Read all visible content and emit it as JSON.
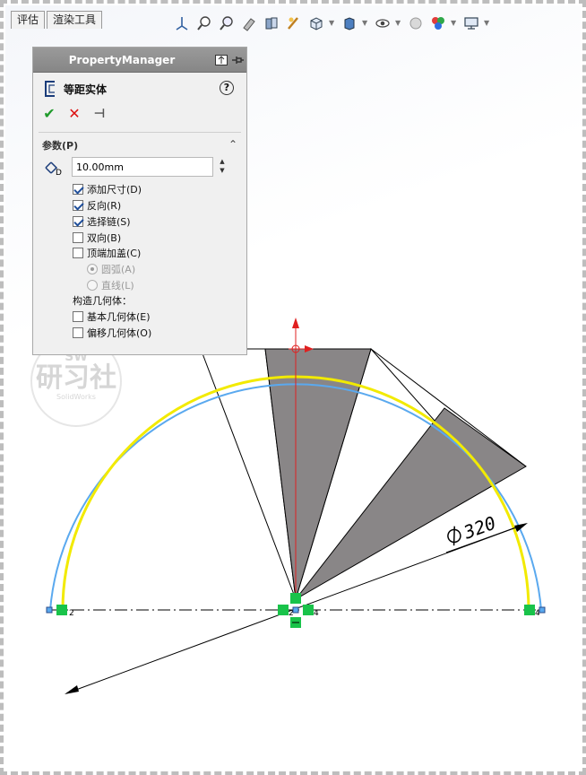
{
  "tabs": [
    {
      "label": "评估"
    },
    {
      "label": "渲染工具"
    }
  ],
  "property_manager": {
    "header_title": "PropertyManager",
    "feature_title": "等距实体",
    "help_label": "?",
    "group_title": "参数(P)",
    "distance_value": "10.00mm",
    "distance_icon_letter": "D",
    "options": [
      {
        "label": "添加尺寸(D)",
        "checked": true
      },
      {
        "label": "反向(R)",
        "checked": true
      },
      {
        "label": "选择链(S)",
        "checked": true
      },
      {
        "label": "双向(B)",
        "checked": false
      },
      {
        "label": "顶端加盖(C)",
        "checked": false
      }
    ],
    "cap_options": [
      {
        "label": "圆弧(A)",
        "selected": true
      },
      {
        "label": "直线(L)",
        "selected": false
      }
    ],
    "construction_label": "构造几何体：",
    "construction_options": [
      {
        "label": "基本几何体(E)",
        "checked": false
      },
      {
        "label": "偏移几何体(O)",
        "checked": false
      }
    ]
  },
  "watermark": {
    "top": "SW",
    "mid": "研习社",
    "bottom": "SolidWorks"
  },
  "drawing": {
    "dimension_label": "320",
    "relation_labels": [
      "2",
      "2",
      "4",
      "4"
    ],
    "colors": {
      "offset_arc": "#5aa9ef",
      "base_arc": "#f2ea00",
      "sector_fill": "#898687",
      "relation_green": "#19c34a",
      "origin_red": "#e02020"
    }
  }
}
